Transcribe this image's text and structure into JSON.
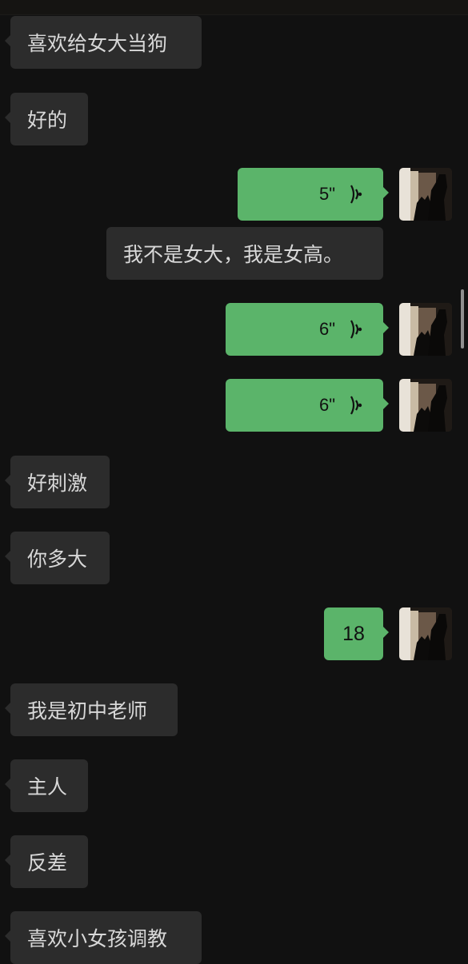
{
  "messages": [
    {
      "side": "in",
      "text": "喜欢给女大当狗"
    },
    {
      "side": "in",
      "text": "好的"
    },
    {
      "side": "out_voice",
      "duration": "5\""
    },
    {
      "side": "in",
      "text": "我不是女大，我是女高。"
    },
    {
      "side": "out_voice",
      "duration": "6\""
    },
    {
      "side": "out_voice",
      "duration": "6\""
    },
    {
      "side": "in",
      "text": "好刺激"
    },
    {
      "side": "in",
      "text": "你多大"
    },
    {
      "side": "out",
      "text": "18"
    },
    {
      "side": "in",
      "text": "我是初中老师"
    },
    {
      "side": "in",
      "text": "主人"
    },
    {
      "side": "in",
      "text": "反差"
    },
    {
      "side": "in",
      "text": "喜欢小女孩调教"
    }
  ],
  "colors": {
    "background": "#111111",
    "incoming_bubble": "#2c2c2c",
    "outgoing_bubble": "#5bb46a"
  },
  "icons": {
    "voice": "voice-wave-icon",
    "avatar": "avatar-photo"
  }
}
